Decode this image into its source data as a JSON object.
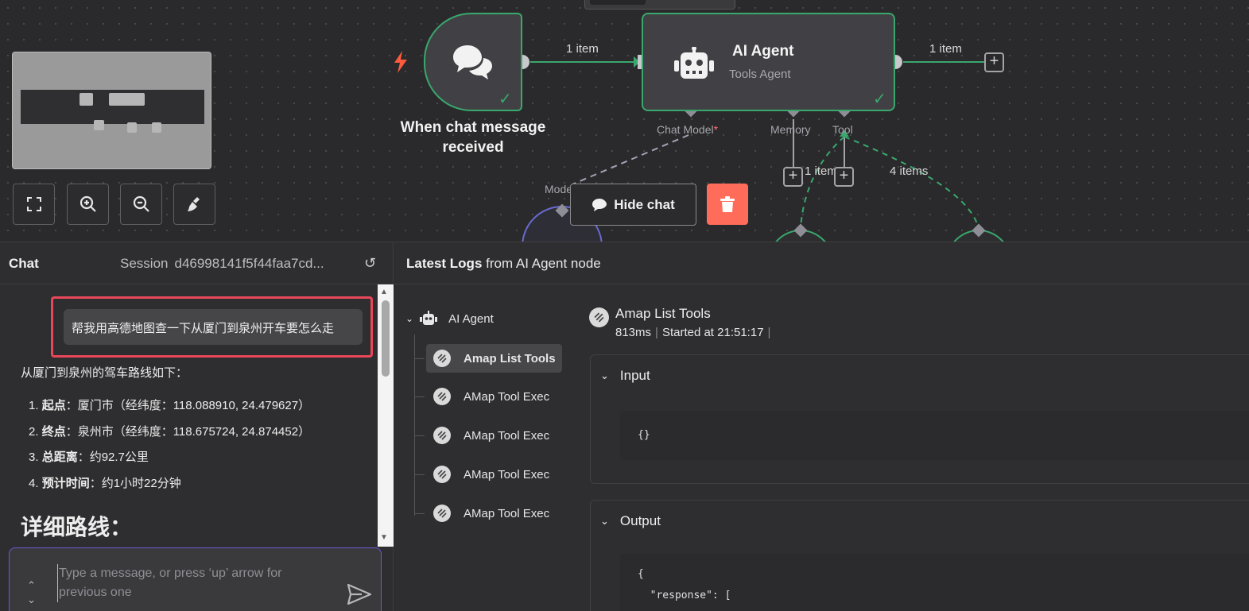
{
  "canvas": {
    "trigger": {
      "label_line1": "When chat message",
      "label_line2": "received"
    },
    "agent": {
      "title": "AI Agent",
      "subtitle": "Tools Agent"
    },
    "ports": {
      "chat_model": "Chat Model",
      "required_mark": "*",
      "memory": "Memory",
      "tool": "Tool",
      "model": "Model"
    },
    "wire_labels": {
      "trigger_to_agent": "1 item",
      "agent_out": "1 item",
      "memory_count": "1 item",
      "tool_count": "4 items"
    },
    "hide_chat_label": "Hide chat",
    "accent": "#3aa76d",
    "delete_color": "#ff6d5a"
  },
  "chat": {
    "title": "Chat",
    "session_label": "Session",
    "session_id": "d46998141f5f44faa7cd...",
    "user_message": "帮我用高德地图查一下从厦门到泉州开车要怎么走",
    "bot_intro": "从厦门到泉州的驾车路线如下：",
    "bot_items": [
      {
        "num": "1.",
        "key": "起点",
        "value": "：厦门市（经纬度：118.088910, 24.479627）"
      },
      {
        "num": "2.",
        "key": "终点",
        "value": "：泉州市（经纬度：118.675724, 24.874452）"
      },
      {
        "num": "3.",
        "key": "总距离",
        "value": "：约92.7公里"
      },
      {
        "num": "4.",
        "key": "预计时间",
        "value": "：约1小时22分钟"
      }
    ],
    "bot_heading": "详细路线：",
    "input_placeholder": "Type a message, or press ‘up’ arrow for previous one"
  },
  "logs": {
    "title_bold": "Latest Logs",
    "title_rest": " from AI Agent node",
    "tree_root": "AI Agent",
    "tree_items": [
      "Amap List Tools",
      "AMap Tool Exec",
      "AMap Tool Exec",
      "AMap Tool Exec",
      "AMap Tool Exec"
    ],
    "detail_title": "Amap List Tools",
    "detail_duration": "813ms",
    "detail_started": "Started at 21:51:17",
    "input_label": "Input",
    "input_code": "{}",
    "output_label": "Output",
    "output_code_line1": "{",
    "output_code_line2": "  \"response\": ["
  }
}
